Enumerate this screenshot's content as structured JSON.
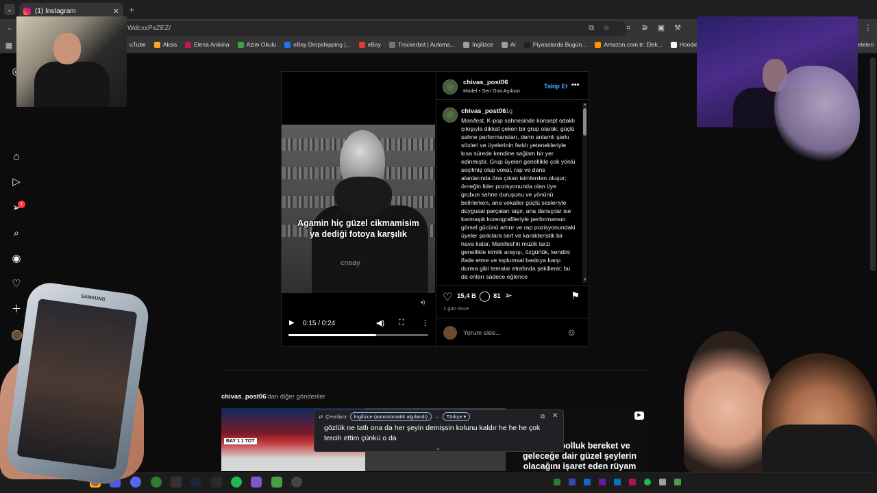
{
  "browser": {
    "tab_title": "(1) Instagram",
    "tab_close": "✕",
    "new_tab": "+",
    "url": "WdcxxPsZEZ/",
    "bookmarks": [
      {
        "label": "uTube",
        "color": "#e53935"
      },
      {
        "label": "Aksis",
        "color": "#f9a825"
      },
      {
        "label": "Elena Anikina",
        "color": "#c2185b"
      },
      {
        "label": "Azim Okulu",
        "color": "#43a047"
      },
      {
        "label": "eBay Dropshipping |...",
        "color": "#1877f2"
      },
      {
        "label": "eBay",
        "color": "#e53935"
      },
      {
        "label": "Trackerbot | Automa...",
        "color": "#757575"
      },
      {
        "label": "İngilizce",
        "color": "#9e9e9e"
      },
      {
        "label": "AI",
        "color": "#9e9e9e"
      },
      {
        "label": "Piyasalarda Bugün...",
        "color": "#212121"
      },
      {
        "label": "Amazon.com.tr: Elek...",
        "color": "#ff9800"
      },
      {
        "label": "Hoodie Modelle",
        "color": "#fafafa"
      }
    ],
    "bookmarks_overflow": "eteleri"
  },
  "sidebar": {
    "notification_count": "1"
  },
  "post": {
    "video": {
      "caption_line1": "Agamin hiç güzel cikmamisim",
      "caption_line2": "ya dediği fotoya karşılık",
      "watermark": "cnsay",
      "time": "0:15 / 0:24",
      "progress": 0.625
    },
    "author": "chivas_post06",
    "subtitle": "Model • Sen Ona Aşıksın",
    "follow_label": "Takip Et",
    "comment": {
      "author": "chivas_post06",
      "age": "1g",
      "text": "Manifest, K-pop sahnesinde konsept odaklı çıkışıyla dikkat çeken bir grup olarak; güçlü sahne performansları, derin anlamlı şarkı sözleri ve üyelerinin farklı yetenekleriyle kısa sürede kendine sağlam bir yer edinmiştir. Grup üyeleri genellikle çok yönlü seçilmiş olup vokal, rap ve dans alanlarında öne çıkan isimlerden oluşur; örneğin lider pozisyonunda olan üye grubun sahne duruşunu ve yönünü belirlerken, ana vokaller güçlü sesleriyle duygusal parçaları taşır, ana dansçılar ise karmaşık koreografileriyle performansın görsel gücünü artırır ve rap pozisyonundaki üyeler şarkılara sert ve karakteristik bir hava katar. Manifest'in müzik tarzı genellikle kimlik arayışı, özgürlük, kendini ifade etme ve toplumsal baskıya karşı durma gibi temalar etrafında şekillenir; bu da onları sadece eğlence"
    },
    "likes": "15,4 B",
    "comments": "81",
    "time_ago": "1 gün önce",
    "add_comment_placeholder": "Yorum ekle..."
  },
  "more_posts": {
    "author": "chivas_post06",
    "suffix": "'dan diğer gönderiler",
    "thumb1_score": "BAY 1 1 TOT",
    "thumb3_text": "Anlamı bolluk bereket ve geleceğe dair güzel şeylerin olacağını işaret eden rüyam"
  },
  "translate": {
    "status": "Çevriliyor",
    "from": "İngilizce (autootomatik algılandı)",
    "arrow": "→",
    "to": "Türkçe",
    "text": "gözlük ne tatlı ona da her şeyin demişsin kolunu kaldır he he he çok tercih ettim çünkü o da"
  },
  "overlay": {
    "phone_brand": "SAMSUNG"
  }
}
